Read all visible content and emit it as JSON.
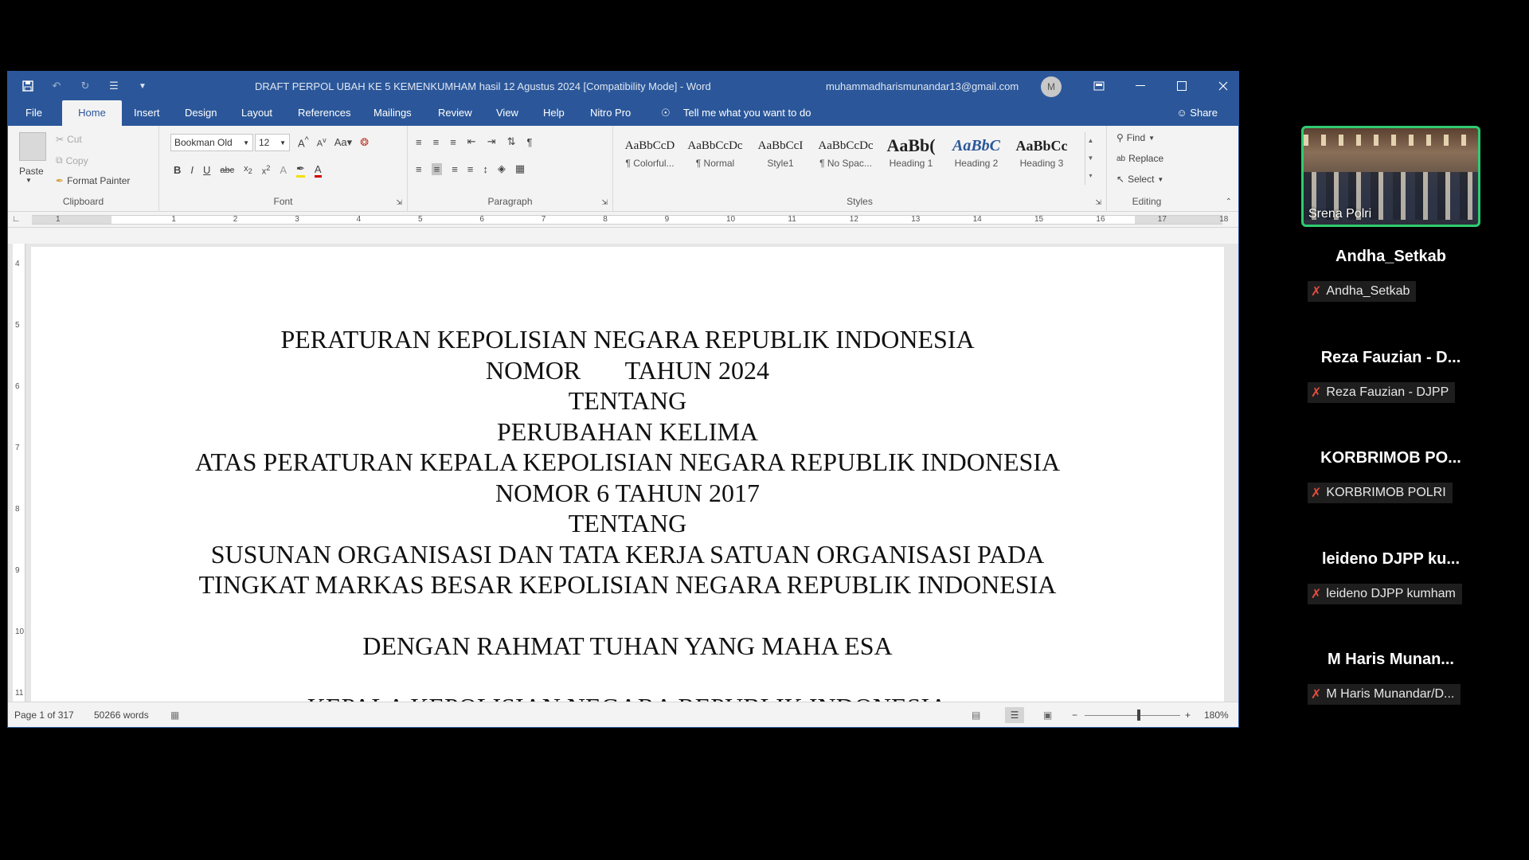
{
  "window": {
    "title": "DRAFT PERPOL UBAH KE 5 KEMENKUMHAM hasil 12 Agustus 2024 [Compatibility Mode]  -  Word",
    "account": "muhammadharismunandar13@gmail.com",
    "avatar_initial": "M"
  },
  "tabs": [
    "File",
    "Home",
    "Insert",
    "Design",
    "Layout",
    "References",
    "Mailings",
    "Review",
    "View",
    "Help",
    "Nitro Pro"
  ],
  "tell_me": "Tell me what you want to do",
  "share": "Share",
  "clipboard": {
    "paste": "Paste",
    "cut": "Cut",
    "copy": "Copy",
    "format_painter": "Format Painter",
    "label": "Clipboard"
  },
  "font": {
    "name": "Bookman Old",
    "size": "12",
    "case": "Aa",
    "label": "Font"
  },
  "paragraph": {
    "label": "Paragraph"
  },
  "styles": {
    "label": "Styles",
    "items": [
      {
        "sample": "AaBbCcD",
        "name": "¶ Colorful..."
      },
      {
        "sample": "AaBbCcDc",
        "name": "¶ Normal"
      },
      {
        "sample": "AaBbCcI",
        "name": "Style1"
      },
      {
        "sample": "AaBbCcDc",
        "name": "¶ No Spac..."
      },
      {
        "sample": "AaBb(",
        "name": "Heading 1"
      },
      {
        "sample": "AaBbC",
        "name": "Heading 2"
      },
      {
        "sample": "AaBbCc",
        "name": "Heading 3"
      }
    ]
  },
  "editing": {
    "find": "Find",
    "replace": "Replace",
    "select": "Select",
    "label": "Editing"
  },
  "ruler_numbers": [
    "1",
    "1",
    "2",
    "3",
    "4",
    "5",
    "6",
    "7",
    "8",
    "9",
    "10",
    "11",
    "12",
    "13",
    "14",
    "15",
    "16",
    "17",
    "18"
  ],
  "vruler_numbers": [
    "4",
    "5",
    "6",
    "7",
    "8",
    "9",
    "10",
    "11"
  ],
  "document_lines": [
    "PERATURAN KEPOLISIAN NEGARA REPUBLIK INDONESIA",
    "NOMOR       TAHUN 2024",
    "TENTANG",
    "PERUBAHAN KELIMA",
    "ATAS PERATURAN KEPALA KEPOLISIAN NEGARA REPUBLIK INDONESIA",
    "NOMOR 6 TAHUN 2017",
    "TENTANG",
    "SUSUNAN ORGANISASI DAN TATA KERJA SATUAN ORGANISASI PADA",
    "TINGKAT MARKAS BESAR KEPOLISIAN NEGARA REPUBLIK INDONESIA",
    "",
    "DENGAN RAHMAT TUHAN YANG MAHA ESA",
    "",
    "KEPALA KEPOLISIAN NEGARA REPUBLIK INDONESIA"
  ],
  "status": {
    "page": "Page 1 of 317",
    "words": "50266 words",
    "zoom": "180%"
  },
  "video": {
    "name": "Srena Polri"
  },
  "participants": [
    {
      "name": "Andha_Setkab",
      "sub": "Andha_Setkab"
    },
    {
      "name": "Reza Fauzian - D...",
      "sub": "Reza Fauzian - DJPP"
    },
    {
      "name": "KORBRIMOB  PO...",
      "sub": "KORBRIMOB POLRI"
    },
    {
      "name": "leideno DJPP ku...",
      "sub": "leideno DJPP kumham"
    },
    {
      "name": "M Haris Munan...",
      "sub": "M Haris Munandar/D..."
    }
  ],
  "colors": {
    "word_blue": "#2b579a",
    "active_speaker": "#2ecc71",
    "muted": "#e74c3c"
  }
}
